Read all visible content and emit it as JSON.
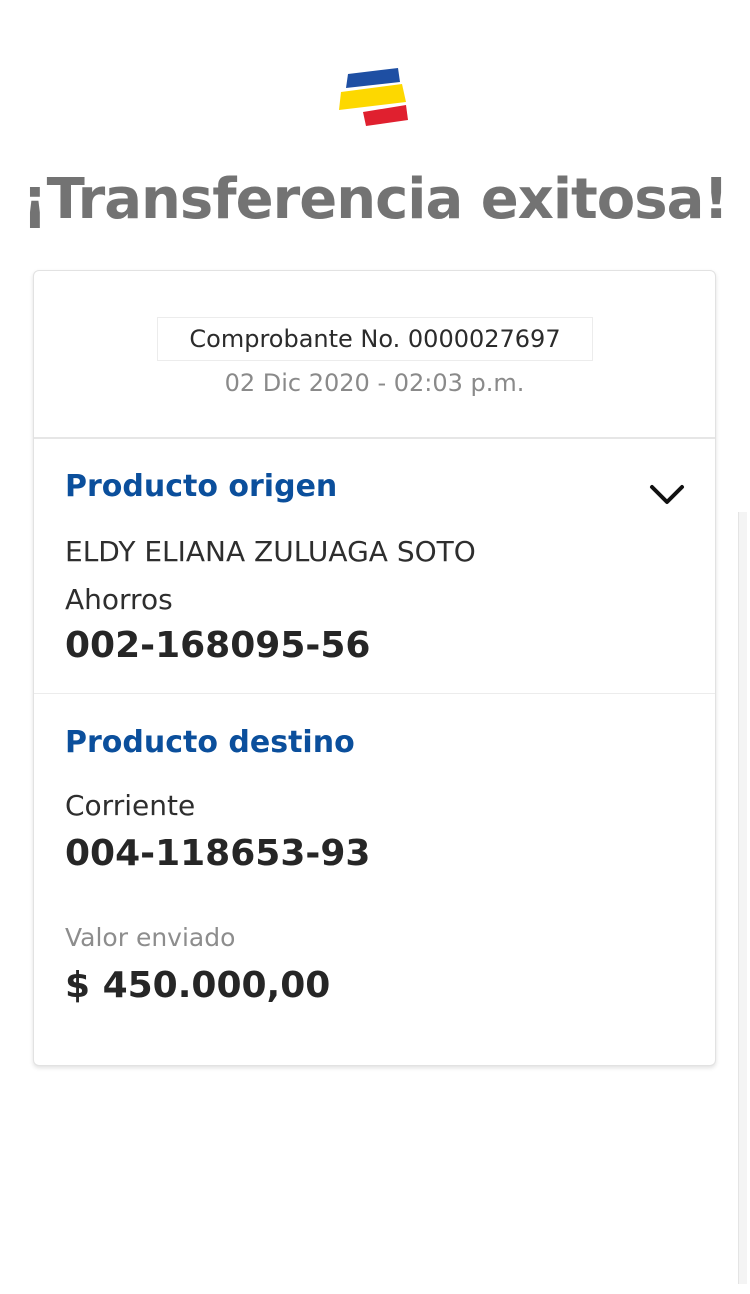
{
  "brand": {
    "logo_icon": "bancolombia-logo-icon",
    "colors": {
      "blue": "#1e4fa3",
      "yellow": "#fdd800",
      "red": "#e0202f"
    }
  },
  "title": "¡Transferencia exitosa!",
  "receipt": {
    "number_label": "Comprobante No. 0000027697",
    "date": "02 Dic 2020 - 02:03 p.m."
  },
  "origin": {
    "title": "Producto origen",
    "owner": "ELDY ELIANA ZULUAGA SOTO",
    "account_type": "Ahorros",
    "account_number": "002-168095-56",
    "toggle_icon": "chevron-down-icon"
  },
  "destination": {
    "title": "Producto destino",
    "account_type": "Corriente",
    "account_number": "004-118653-93"
  },
  "amount": {
    "label": "Valor enviado",
    "value": "$ 450.000,00"
  },
  "colors": {
    "title_gray": "#737373",
    "section_blue": "#0b4f9c"
  }
}
